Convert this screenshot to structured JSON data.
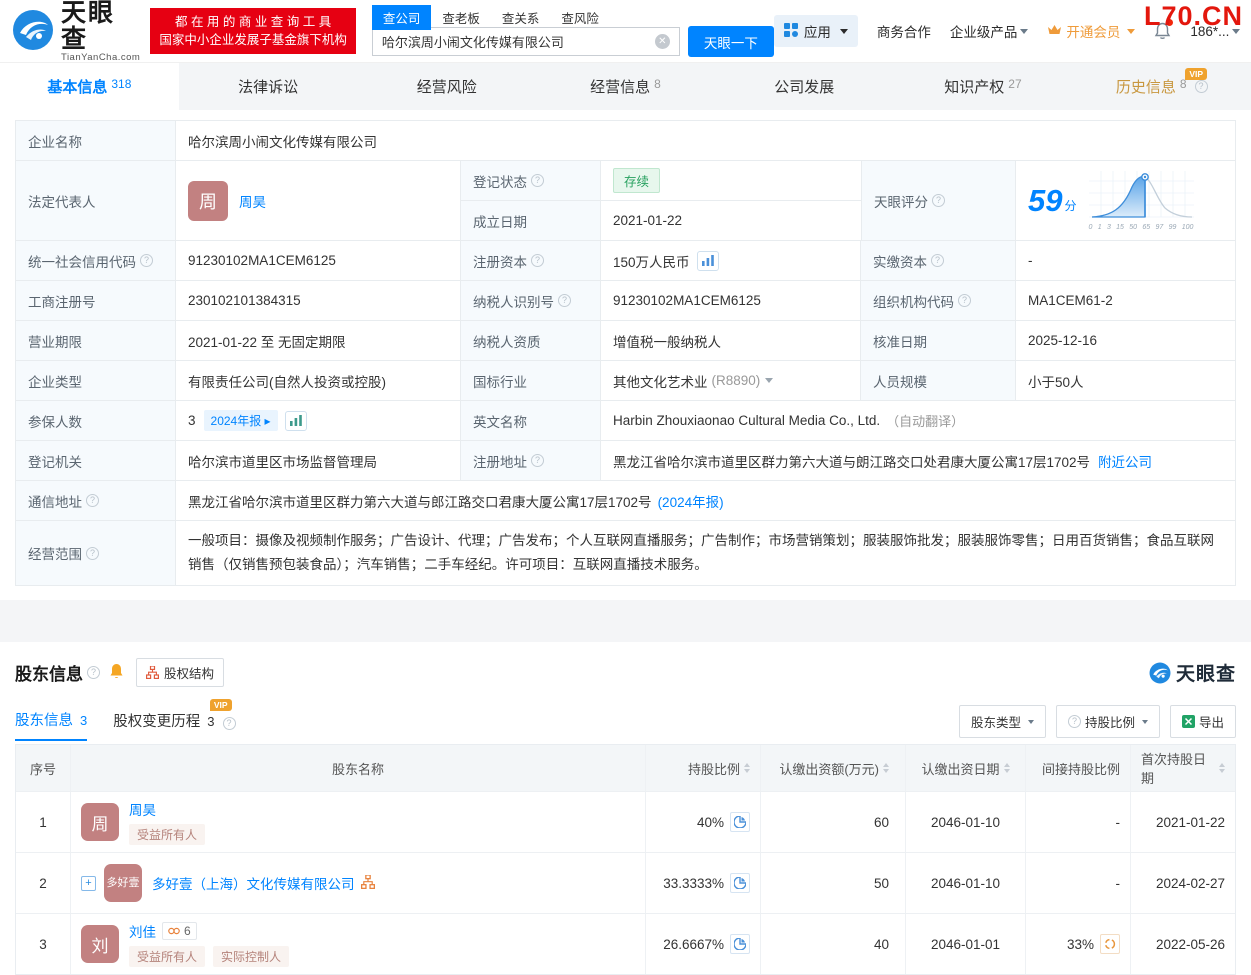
{
  "watermark": "L70.CN",
  "header": {
    "brand": {
      "name": "天眼查",
      "domain": "TianYanCha.com"
    },
    "promo": {
      "line1": "都 在 用 的 商 业 查 询 工 具",
      "line2": "国家中小企业发展子基金旗下机构"
    },
    "search": {
      "tabs": [
        {
          "label": "查公司"
        },
        {
          "label": "查老板"
        },
        {
          "label": "查关系"
        },
        {
          "label": "查风险"
        }
      ],
      "value": "哈尔滨周小闹文化传媒有限公司",
      "button": "天眼一下"
    },
    "menu": {
      "apps": "应用",
      "cooperation": "商务合作",
      "enterprise": "企业级产品",
      "vip": "开通会员",
      "user": "186*..."
    }
  },
  "nav": {
    "tabs": [
      {
        "label": "基本信息",
        "count": "318"
      },
      {
        "label": "法律诉讼",
        "count": ""
      },
      {
        "label": "经营风险",
        "count": ""
      },
      {
        "label": "经营信息",
        "count": "8"
      },
      {
        "label": "公司发展",
        "count": ""
      },
      {
        "label": "知识产权",
        "count": "27"
      },
      {
        "label": "历史信息",
        "count": "8",
        "vip": "VIP"
      }
    ]
  },
  "basic": {
    "company_name": {
      "label": "企业名称",
      "value": "哈尔滨周小闹文化传媒有限公司"
    },
    "legal_rep": {
      "label": "法定代表人",
      "avatar": "周",
      "name": "周昊"
    },
    "reg_status": {
      "label": "登记状态",
      "value": "存续"
    },
    "establish_date": {
      "label": "成立日期",
      "value": "2021-01-22"
    },
    "score": {
      "label": "天眼评分",
      "value": "59",
      "unit": "分",
      "axis": [
        "0",
        "1",
        "3",
        "15",
        "50",
        "65",
        "97",
        "99",
        "100"
      ]
    },
    "credit_code": {
      "label": "统一社会信用代码",
      "value": "91230102MA1CEM6125"
    },
    "reg_capital": {
      "label": "注册资本",
      "value": "150万人民币"
    },
    "paid_capital": {
      "label": "实缴资本",
      "value": "-"
    },
    "reg_number": {
      "label": "工商注册号",
      "value": "230102101384315"
    },
    "taxpayer_id": {
      "label": "纳税人识别号",
      "value": "91230102MA1CEM6125"
    },
    "org_code": {
      "label": "组织机构代码",
      "value": "MA1CEM61-2"
    },
    "business_term": {
      "label": "营业期限",
      "value": "2021-01-22 至 无固定期限"
    },
    "taxpayer_quality": {
      "label": "纳税人资质",
      "value": "增值税一般纳税人"
    },
    "approval_date": {
      "label": "核准日期",
      "value": "2025-12-16"
    },
    "company_type": {
      "label": "企业类型",
      "value": "有限责任公司(自然人投资或控股)"
    },
    "industry": {
      "label": "国标行业",
      "value": "其他文化艺术业",
      "code": "(R8890)"
    },
    "staff_size": {
      "label": "人员规模",
      "value": "小于50人"
    },
    "insured": {
      "label": "参保人数",
      "value": "3",
      "report_tag": "2024年报 ▸"
    },
    "english_name": {
      "label": "英文名称",
      "value": "Harbin Zhouxiaonao Cultural Media Co., Ltd.",
      "note": "（自动翻译）"
    },
    "reg_authority": {
      "label": "登记机关",
      "value": "哈尔滨市道里区市场监督管理局"
    },
    "reg_address": {
      "label": "注册地址",
      "value": "黑龙江省哈尔滨市道里区群力第六大道与朗江路交口处君康大厦公寓17层1702号",
      "link": "附近公司"
    },
    "mail_address": {
      "label": "通信地址",
      "value": "黑龙江省哈尔滨市道里区群力第六大道与郎江路交口君康大厦公寓17层1702号",
      "link": "(2024年报)"
    },
    "business_scope": {
      "label": "经营范围",
      "value": "一般项目：摄像及视频制作服务；广告设计、代理；广告发布；个人互联网直播服务；广告制作；市场营销策划；服装服饰批发；服装服饰零售；日用百货销售；食品互联网销售（仅销售预包装食品）；汽车销售；二手车经纪。许可项目：互联网直播技术服务。"
    }
  },
  "shareholders": {
    "title": "股东信息",
    "structure_button": "股权结构",
    "brand": "天眼查",
    "tabs": [
      {
        "label": "股东信息",
        "count": "3"
      },
      {
        "label": "股权变更历程",
        "count": "3",
        "vip": "VIP"
      }
    ],
    "filters": {
      "type": "股东类型",
      "ratio": "持股比例",
      "export": "导出"
    },
    "columns": [
      "序号",
      "股东名称",
      "持股比例",
      "认缴出资额(万元)",
      "认缴出资日期",
      "间接持股比例",
      "首次持股日期"
    ],
    "rows": [
      {
        "index": "1",
        "avatar": "周",
        "name": "周昊",
        "tags": [
          "受益所有人"
        ],
        "ratio": "40%",
        "amount": "60",
        "date": "2046-01-10",
        "indirect": "-",
        "first_date": "2021-01-22"
      },
      {
        "index": "2",
        "avatar": "多好壹",
        "name": "多好壹（上海）文化传媒有限公司",
        "expander": "+",
        "ratio": "33.3333%",
        "amount": "50",
        "date": "2046-01-10",
        "indirect": "-",
        "first_date": "2024-02-27"
      },
      {
        "index": "3",
        "avatar": "刘",
        "name": "刘佳",
        "badge": "6",
        "tags": [
          "受益所有人",
          "实际控制人"
        ],
        "ratio": "26.6667%",
        "amount": "40",
        "date": "2046-01-01",
        "indirect": "33%",
        "first_date": "2022-05-26"
      }
    ]
  }
}
